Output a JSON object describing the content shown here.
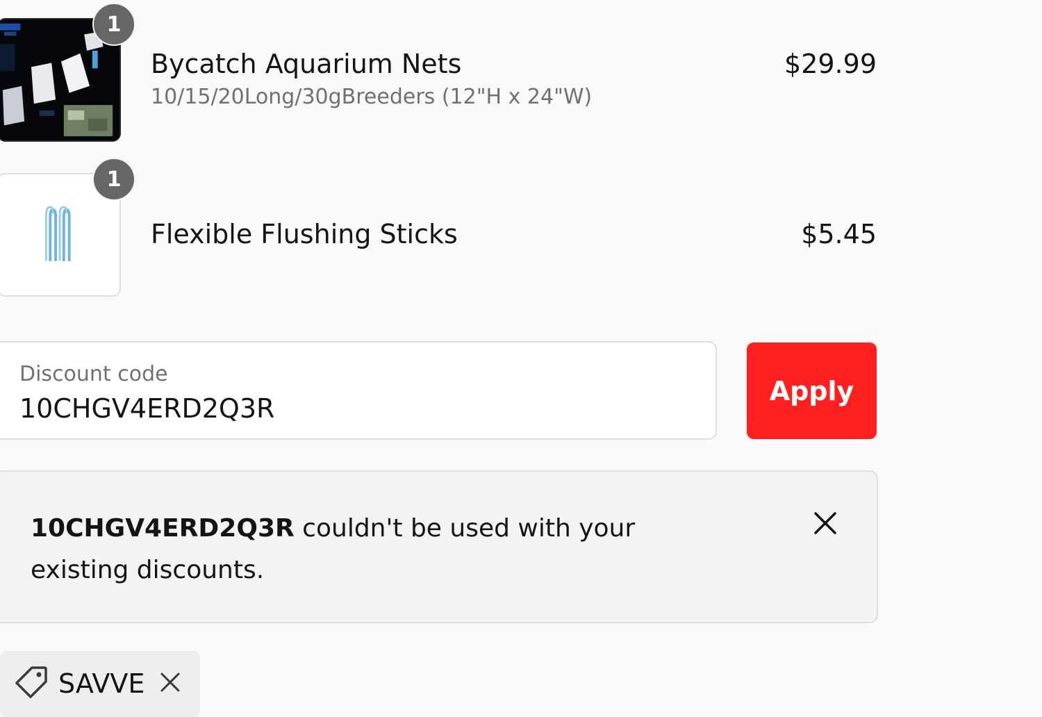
{
  "colors": {
    "page_background": "#f9f9f9",
    "apply_button": "#ff1f1f",
    "badge": "#676767",
    "banner_background": "#f3f3f3",
    "text_primary": "#141414",
    "text_secondary": "#707070"
  },
  "line_items": [
    {
      "quantity": "1",
      "title": "Bycatch Aquarium Nets",
      "variant": "10/15/20Long/30gBreeders (12\"H x 24\"W)",
      "price": "$29.99",
      "image": "aquarium-nets-product-photo"
    },
    {
      "quantity": "1",
      "title": "Flexible Flushing Sticks",
      "price": "$5.45",
      "image": "flushing-sticks-product-photo"
    }
  ],
  "discount": {
    "label": "Discount code",
    "value": "10CHGV4ERD2Q3R",
    "apply_label": "Apply"
  },
  "error": {
    "code": "10CHGV4ERD2Q3R",
    "message": " couldn't be used with your existing discounts.",
    "close_icon": "close-icon"
  },
  "applied_discount": {
    "icon": "tag-icon",
    "code": "SAVVE",
    "remove_icon": "close-icon"
  }
}
